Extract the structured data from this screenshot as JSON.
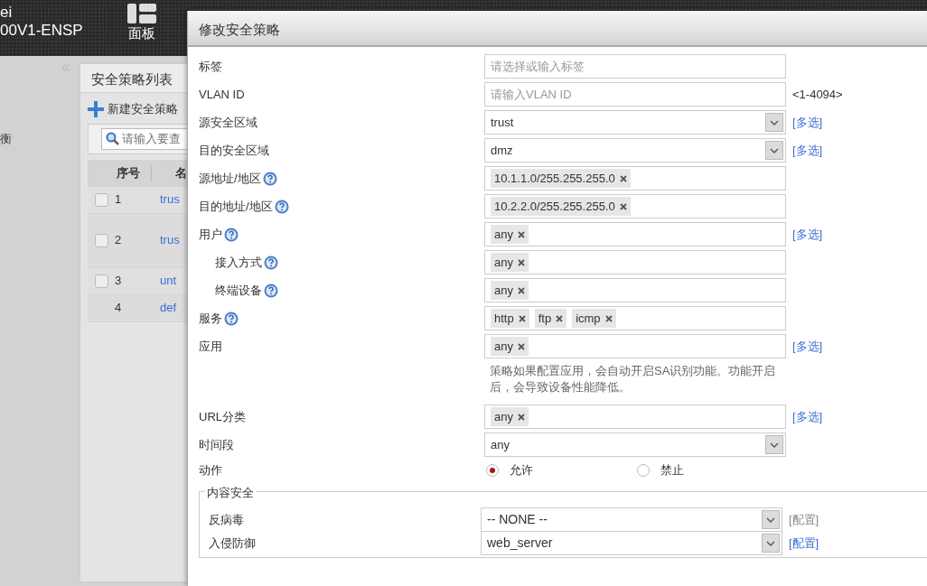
{
  "header": {
    "brand_lines": [
      "ei",
      "00V1-ENSP"
    ],
    "nav": [
      {
        "label": "面板",
        "selected": true
      }
    ]
  },
  "sidebar": {
    "items": [
      {
        "label": "衡"
      }
    ]
  },
  "policy_list": {
    "title": "安全策略列表",
    "new_button": "新建安全策略",
    "search": {
      "placeholder": "请输入要查"
    },
    "columns": [
      "序号",
      "名"
    ],
    "rows": [
      {
        "kind": "policy",
        "no": "1",
        "name": "trus",
        "checked": false
      },
      {
        "kind": "policy",
        "no": "2",
        "name": "trus",
        "checked": false
      },
      {
        "kind": "policy",
        "no": "3",
        "name": "unt",
        "checked": false
      },
      {
        "kind": "default",
        "no": "4",
        "name": "def"
      }
    ]
  },
  "dialog": {
    "title": "修改安全策略",
    "fields": [
      {
        "kind": "input",
        "label": "标签",
        "placeholder": "请选择或输入标签"
      },
      {
        "kind": "input",
        "label": "VLAN ID",
        "placeholder": "请输入VLAN ID",
        "hint": "<1-4094>"
      },
      {
        "kind": "select",
        "label": "源安全区域",
        "value": "trust",
        "link": "[多选]"
      },
      {
        "kind": "select",
        "label": "目的安全区域",
        "value": "dmz",
        "link": "[多选]"
      },
      {
        "kind": "tags",
        "label": "源地址/地区",
        "help": true,
        "tags": [
          "10.1.1.0/255.255.255.0"
        ]
      },
      {
        "kind": "tags",
        "label": "目的地址/地区",
        "help": true,
        "tags": [
          "10.2.2.0/255.255.255.0"
        ]
      },
      {
        "kind": "tags",
        "label": "用户",
        "help": true,
        "tags": [
          "any"
        ],
        "link": "[多选]",
        "children": [
          {
            "kind": "tags",
            "label": "接入方式",
            "help": true,
            "tags": [
              "any"
            ]
          },
          {
            "kind": "tags",
            "label": "终端设备",
            "help": true,
            "tags": [
              "any"
            ]
          }
        ]
      },
      {
        "kind": "tags",
        "label": "服务",
        "help": true,
        "tags": [
          "http",
          "ftp",
          "icmp"
        ]
      },
      {
        "kind": "tags",
        "label": "应用",
        "tags": [
          "any"
        ],
        "link": "[多选]"
      },
      {
        "kind": "note",
        "text": "策略如果配置应用，会自动开启SA识别功能。功能开启后，会导致设备性能降低。"
      },
      {
        "kind": "tags",
        "label": "URL分类",
        "tags": [
          "any"
        ],
        "link": "[多选]"
      },
      {
        "kind": "select",
        "label": "时间段",
        "value": "any"
      },
      {
        "kind": "radio",
        "label": "动作",
        "options": [
          {
            "label": "允许",
            "selected": true
          },
          {
            "label": "禁止",
            "selected": false
          }
        ]
      }
    ],
    "content_security": {
      "legend": "内容安全",
      "rows": [
        {
          "label": "反病毒",
          "value": "-- NONE --",
          "link": "[配置]",
          "disabled": true
        },
        {
          "label": "入侵防御",
          "value": "web_server",
          "link": "[配置]",
          "disabled": false
        }
      ]
    }
  }
}
